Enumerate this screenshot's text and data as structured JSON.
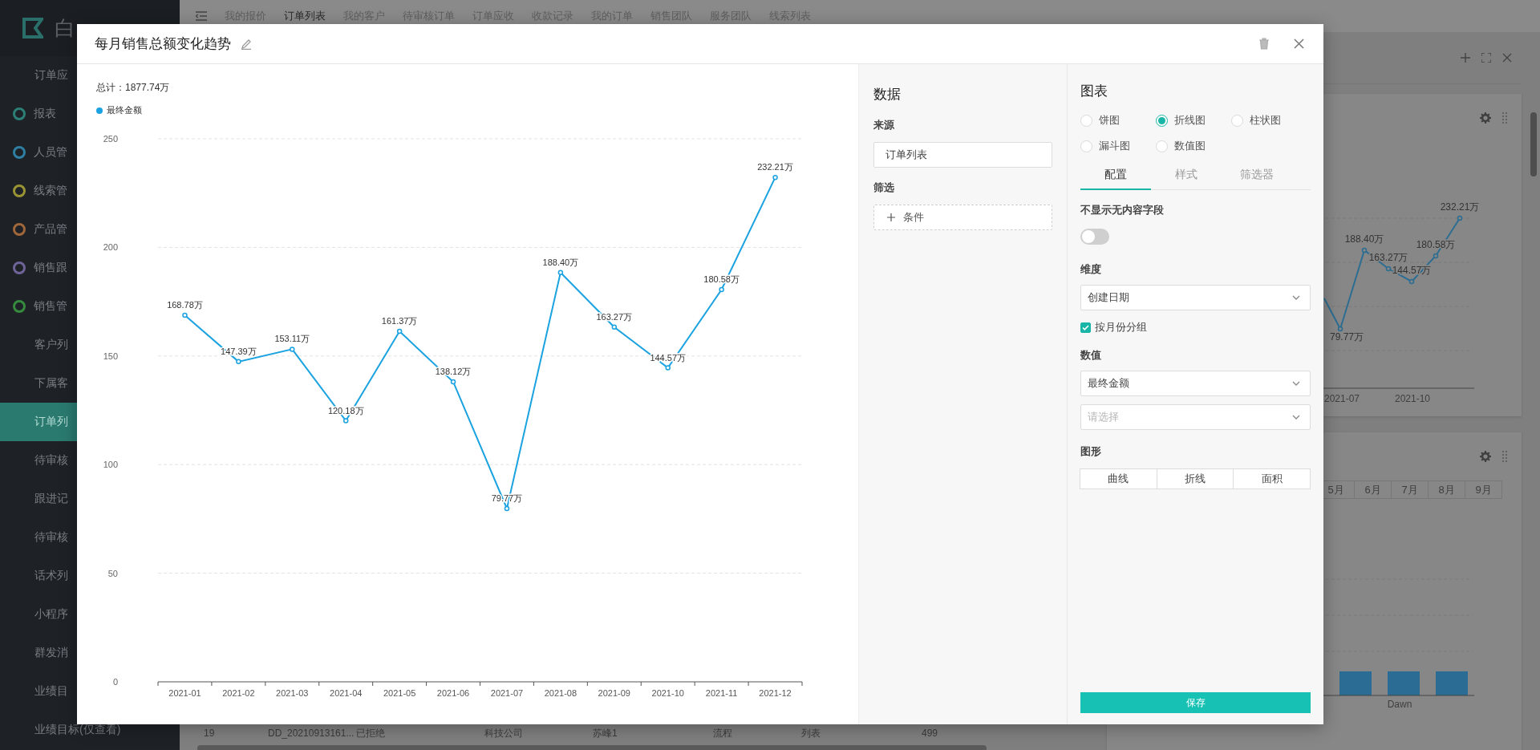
{
  "sidebar": {
    "logo_text": "白",
    "items": [
      {
        "label": "订单应",
        "kind": "link",
        "selected": false
      },
      {
        "label": "报表",
        "kind": "group",
        "color": "#2c7f76",
        "selected": false
      },
      {
        "label": "人员管",
        "kind": "group",
        "color": "#2f7fa3",
        "selected": false
      },
      {
        "label": "线索管",
        "kind": "group",
        "color": "#9a9433",
        "selected": false
      },
      {
        "label": "产品管",
        "kind": "group",
        "color": "#a0673a",
        "selected": false
      },
      {
        "label": "销售跟",
        "kind": "group",
        "color": "#6f6499",
        "selected": false
      },
      {
        "label": "销售管",
        "kind": "group",
        "color": "#368a3e",
        "selected": false
      },
      {
        "label": "客户列",
        "kind": "link",
        "selected": false
      },
      {
        "label": "下属客",
        "kind": "link",
        "selected": false
      },
      {
        "label": "订单列",
        "kind": "link",
        "selected": true
      },
      {
        "label": "待审核",
        "kind": "link",
        "selected": false
      },
      {
        "label": "跟进记",
        "kind": "link",
        "selected": false
      },
      {
        "label": "待审核",
        "kind": "link",
        "selected": false
      },
      {
        "label": "话术列",
        "kind": "link",
        "selected": false
      },
      {
        "label": "小程序",
        "kind": "link",
        "selected": false
      },
      {
        "label": "群发消",
        "kind": "link",
        "selected": false
      },
      {
        "label": "业绩目",
        "kind": "link",
        "selected": false
      },
      {
        "label": "业绩目标(仅查看)",
        "kind": "link",
        "selected": false
      }
    ]
  },
  "top_tabs": [
    {
      "label": "我的报价",
      "selected": false
    },
    {
      "label": "订单列表",
      "selected": true
    },
    {
      "label": "我的客户",
      "selected": false
    },
    {
      "label": "待审核订单",
      "selected": false
    },
    {
      "label": "订单应收",
      "selected": false
    },
    {
      "label": "收款记录",
      "selected": false
    },
    {
      "label": "我的订单",
      "selected": false
    },
    {
      "label": "销售团队",
      "selected": false
    },
    {
      "label": "服务团队",
      "selected": false
    },
    {
      "label": "线索列表",
      "selected": false
    }
  ],
  "dashboard": {
    "line_card": {
      "value_labels": [
        "79.77万",
        "188.40万",
        "163.27万",
        "144.57万",
        "180.58万",
        "232.21万"
      ],
      "x_labels": [
        "2021-07",
        "2021-10"
      ]
    },
    "bar_card": {
      "months": [
        "5月",
        "6月",
        "7月",
        "8月",
        "9月"
      ],
      "x_label": "Dawn"
    }
  },
  "table_row": {
    "cells": [
      "19",
      "DD_20210913161...",
      "已拒绝",
      "科技公司",
      "苏峰1",
      "流程",
      "列表",
      "499"
    ]
  },
  "modal": {
    "title": "每月销售总额变化趋势",
    "chart": {
      "total": "总计：1877.74万",
      "chart_data": {
        "type": "line",
        "categories": [
          "2021-01",
          "2021-02",
          "2021-03",
          "2021-04",
          "2021-05",
          "2021-06",
          "2021-07",
          "2021-08",
          "2021-09",
          "2021-10",
          "2021-11",
          "2021-12"
        ],
        "grid": true,
        "series": [
          {
            "name": "最终金额",
            "color": "#1aa3e0",
            "marker": true,
            "values": [
              168.78,
              147.39,
              153.11,
              120.18,
              161.37,
              138.12,
              79.77,
              188.4,
              163.27,
              144.57,
              180.58,
              232.21
            ]
          }
        ],
        "ylim": [
          0,
          250
        ],
        "yticks": [
          0,
          50,
          100,
          150,
          200,
          250
        ],
        "value_labels": [
          "168.78万",
          "147.39万",
          "153.11万",
          "120.18万",
          "161.37万",
          "138.12万",
          "79.77万",
          "188.40万",
          "163.27万",
          "144.57万",
          "180.58万",
          "232.21万"
        ]
      }
    },
    "data_panel": {
      "title": "数据",
      "source_label": "来源",
      "source_value": "订单列表",
      "filter_label": "筛选",
      "add_condition": "条件"
    },
    "config_panel": {
      "title": "图表",
      "chart_types": [
        {
          "label": "饼图",
          "selected": false
        },
        {
          "label": "折线图",
          "selected": true
        },
        {
          "label": "柱状图",
          "selected": false
        },
        {
          "label": "漏斗图",
          "selected": false
        },
        {
          "label": "数值图",
          "selected": false
        }
      ],
      "tabs": [
        {
          "label": "配置",
          "selected": true
        },
        {
          "label": "样式",
          "selected": false
        },
        {
          "label": "筛选器",
          "selected": false
        }
      ],
      "hide_empty_label": "不显示无内容字段",
      "hide_empty_on": false,
      "dimension_label": "维度",
      "dimension_value": "创建日期",
      "group_by_month": {
        "label": "按月份分组",
        "checked": true
      },
      "value_label": "数值",
      "value_field": "最终金额",
      "second_value_placeholder": "请选择",
      "shape_label": "图形",
      "shapes": [
        "曲线",
        "折线",
        "面积"
      ],
      "save": "保存"
    }
  }
}
